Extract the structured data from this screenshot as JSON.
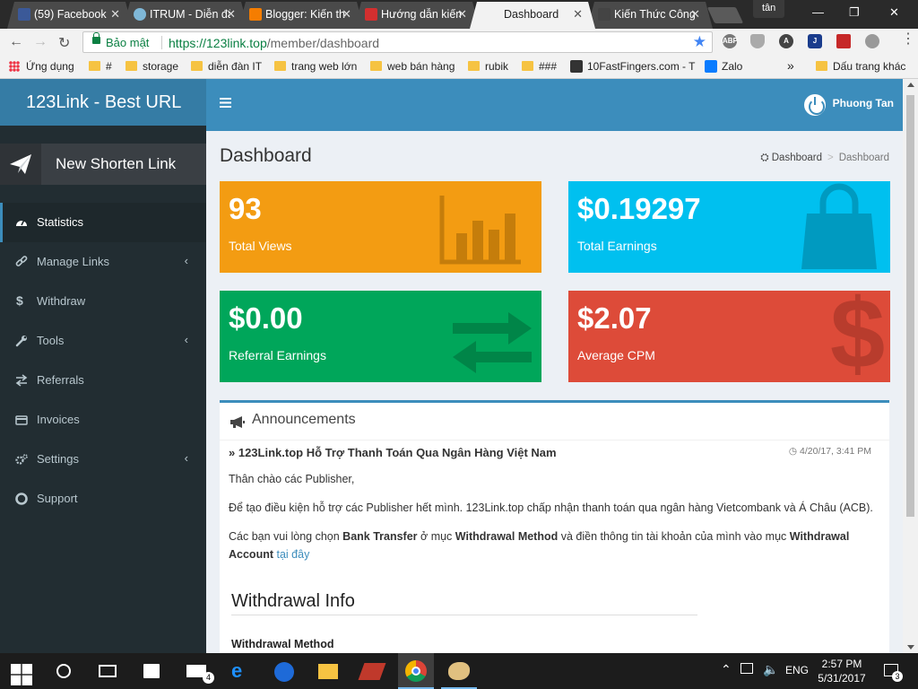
{
  "browser": {
    "tabs": [
      {
        "label": "(59) Facebook",
        "favicon_color": "#3b5998"
      },
      {
        "label": "ITRUM - Diễn đàn",
        "favicon_color": "#7fb8d8"
      },
      {
        "label": "Blogger: Kiến thức",
        "favicon_color": "#f57d00"
      },
      {
        "label": "Hướng dẫn kiếm",
        "favicon_color": "#d32f2f"
      },
      {
        "label": "Dashboard",
        "favicon_color": "#f2f2f2"
      },
      {
        "label": "Kiến Thức Công",
        "favicon_color": "#444444"
      }
    ],
    "profile_name": "tân",
    "secure_label": "Bảo mật",
    "url_host": "https://123link.top",
    "url_path": "/member/dashboard",
    "extensions": [
      "ABP",
      "shield",
      "A",
      "J",
      "pdf",
      "cast"
    ],
    "bookmarks": [
      {
        "label": "Ứng dụng",
        "type": "apps"
      },
      {
        "label": "#",
        "type": "folder"
      },
      {
        "label": "storage",
        "type": "folder"
      },
      {
        "label": "diễn đàn IT",
        "type": "folder"
      },
      {
        "label": "trang web lớn",
        "type": "folder"
      },
      {
        "label": "web bán hàng",
        "type": "folder"
      },
      {
        "label": "rubik",
        "type": "folder"
      },
      {
        "label": "###",
        "type": "folder"
      },
      {
        "label": "10FastFingers.com - T",
        "type": "site"
      },
      {
        "label": "Zalo",
        "type": "site"
      },
      {
        "label": "»",
        "type": "more"
      },
      {
        "label": "Dấu trang khác",
        "type": "folder"
      }
    ]
  },
  "app": {
    "brand": "123Link - Best URL",
    "user_name": "Phuong Tan",
    "new_link_label": "New Shorten Link",
    "menu": [
      {
        "label": "Statistics",
        "icon": "dashboard-icon",
        "active": true,
        "has_children": false
      },
      {
        "label": "Manage Links",
        "icon": "link-icon",
        "active": false,
        "has_children": true
      },
      {
        "label": "Withdraw",
        "icon": "dollar-icon",
        "active": false,
        "has_children": false
      },
      {
        "label": "Tools",
        "icon": "wrench-icon",
        "active": false,
        "has_children": true
      },
      {
        "label": "Referrals",
        "icon": "exchange-icon",
        "active": false,
        "has_children": false
      },
      {
        "label": "Invoices",
        "icon": "credit-card-icon",
        "active": false,
        "has_children": false
      },
      {
        "label": "Settings",
        "icon": "cogs-icon",
        "active": false,
        "has_children": true
      },
      {
        "label": "Support",
        "icon": "lifebuoy-icon",
        "active": false,
        "has_children": false
      }
    ]
  },
  "content": {
    "title": "Dashboard",
    "breadcrumb": [
      "Dashboard",
      "Dashboard"
    ],
    "stats": [
      {
        "value": "93",
        "label": "Total Views",
        "color": "#f39c12",
        "icon": "bar-chart-icon"
      },
      {
        "value": "$0.19297",
        "label": "Total Earnings",
        "color": "#00c0ef",
        "icon": "shopping-bag-icon"
      },
      {
        "value": "$0.00",
        "label": "Referral Earnings",
        "color": "#00a65a",
        "icon": "exchange-arrows-icon"
      },
      {
        "value": "$2.07",
        "label": "Average CPM",
        "color": "#dd4b39",
        "icon": "dollar-sign-icon"
      }
    ],
    "announcements": {
      "heading": "Announcements",
      "post_title": "123Link.top Hỗ Trợ Thanh Toán Qua Ngân Hàng Việt Nam",
      "post_date": "4/20/17, 3:41 PM",
      "greeting": "Thân chào các Publisher,",
      "para1": "Để tạo điều kiện hỗ trợ các Publisher hết mình. 123Link.top chấp nhận thanh toán qua ngân hàng Vietcombank và Á Châu (ACB).",
      "para2_a": "Các bạn vui lòng chọn ",
      "para2_b": "Bank Transfer",
      "para2_c": " ở mục ",
      "para2_d": "Withdrawal Method",
      "para2_e": " và điền thông tin tài khoản của mình vào mục ",
      "para2_f": "Withdrawal Account",
      "para2_link": "tại đây",
      "withdraw_title": "Withdrawal Info",
      "withdraw_method": "Withdrawal Method"
    }
  },
  "taskbar": {
    "language": "ENG",
    "time": "2:57 PM",
    "date": "5/31/2017",
    "mail_badge": "4",
    "notification_badge": "3"
  }
}
